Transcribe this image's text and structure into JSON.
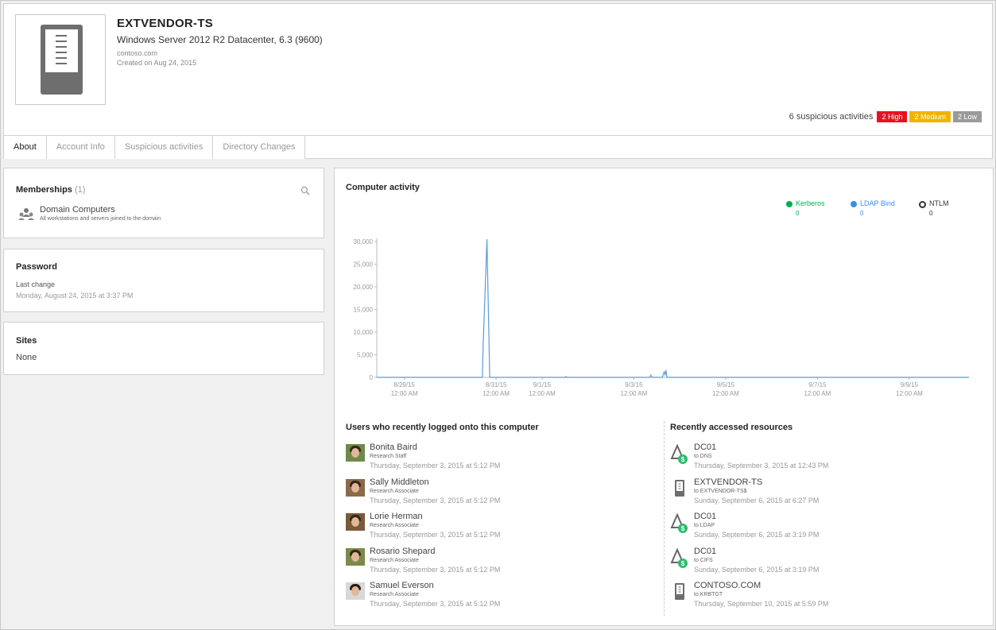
{
  "header": {
    "title": "EXTVENDOR-TS",
    "subtitle": "Windows Server 2012 R2 Datacenter, 6.3 (9600)",
    "domain": "contoso.com",
    "created": "Created on Aug 24, 2015",
    "suspicious_label": "6 suspicious activities",
    "badges": [
      {
        "label": "2 High",
        "color": "#e81123"
      },
      {
        "label": "2 Medium",
        "color": "#f0b400"
      },
      {
        "label": "2 Low",
        "color": "#9a9a9a"
      }
    ]
  },
  "tabs": [
    "About",
    "Account Info",
    "Suspicious activities",
    "Directory Changes"
  ],
  "memberships": {
    "title": "Memberships",
    "count": "(1)",
    "group_name": "Domain Computers",
    "group_desc": "All workstations and servers joined to the domain"
  },
  "password": {
    "title": "Password",
    "label": "Last change",
    "value": "Monday, August 24, 2015 at 3:37 PM"
  },
  "sites": {
    "title": "Sites",
    "value": "None"
  },
  "activity": {
    "title": "Computer activity",
    "legend": [
      {
        "name": "Kerberos",
        "value": "0",
        "color": "#00b050"
      },
      {
        "name": "LDAP Bind",
        "value": "0",
        "color": "#3a8ee6"
      },
      {
        "name": "NTLM",
        "value": "0",
        "color": "#333333"
      }
    ]
  },
  "chart_data": {
    "type": "line",
    "title": "Computer activity",
    "ylim": [
      0,
      30000
    ],
    "yticks": [
      "0",
      "5,000",
      "10,000",
      "15,000",
      "20,000",
      "25,000",
      "30,000"
    ],
    "xticks": [
      {
        "date": "8/29/15",
        "time": "12:00 AM",
        "day": 0
      },
      {
        "date": "8/31/15",
        "time": "12:00 AM",
        "day": 2
      },
      {
        "date": "9/1/15",
        "time": "12:00 AM",
        "day": 3
      },
      {
        "date": "9/3/15",
        "time": "12:00 AM",
        "day": 5
      },
      {
        "date": "9/5/15",
        "time": "12:00 AM",
        "day": 7
      },
      {
        "date": "9/7/15",
        "time": "12:00 AM",
        "day": 9
      },
      {
        "date": "9/9/15",
        "time": "12:00 AM",
        "day": 11
      }
    ],
    "series": [
      {
        "name": "LDAP Bind",
        "color": "#5b9bd5",
        "points": [
          [
            -0.6,
            0
          ],
          [
            1.7,
            0
          ],
          [
            1.72,
            8000
          ],
          [
            1.8,
            30500
          ],
          [
            1.86,
            0
          ],
          [
            2.9,
            0
          ],
          [
            3.5,
            0
          ],
          [
            3.52,
            200
          ],
          [
            3.54,
            0
          ],
          [
            5.0,
            0
          ],
          [
            5.35,
            0
          ],
          [
            5.37,
            500
          ],
          [
            5.4,
            0
          ],
          [
            5.62,
            0
          ],
          [
            5.66,
            1200
          ],
          [
            5.68,
            600
          ],
          [
            5.7,
            1600
          ],
          [
            5.72,
            0
          ],
          [
            12.3,
            0
          ]
        ]
      }
    ],
    "xmin_day": -0.6,
    "xmax_day": 12.3
  },
  "users": {
    "title": "Users who recently logged onto this computer",
    "items": [
      {
        "name": "Bonita Baird",
        "role": "Research Staff",
        "time": "Thursday, September 3, 2015 at 5:12 PM"
      },
      {
        "name": "Sally Middleton",
        "role": "Research Associate",
        "time": "Thursday, September 3, 2015 at 5:12 PM"
      },
      {
        "name": "Lorie Herman",
        "role": "Research Associate",
        "time": "Thursday, September 3, 2015 at 5:12 PM"
      },
      {
        "name": "Rosario Shepard",
        "role": "Research Associate",
        "time": "Thursday, September 3, 2015 at 5:12 PM"
      },
      {
        "name": "Samuel Everson",
        "role": "Research Associate",
        "time": "Thursday, September 3, 2015 at 5:12 PM"
      }
    ]
  },
  "resources": {
    "title": "Recently accessed resources",
    "items": [
      {
        "name": "DC01",
        "target": "to DNS",
        "time": "Thursday, September 3, 2015 at 12:43 PM",
        "icon": "domain-controller-icon"
      },
      {
        "name": "EXTVENDOR-TS",
        "target": "to EXTVENDOR-TS$",
        "time": "Sunday, September 6, 2015 at 6:27 PM",
        "icon": "computer-icon"
      },
      {
        "name": "DC01",
        "target": "to LDAP",
        "time": "Sunday, September 6, 2015 at 3:19 PM",
        "icon": "domain-controller-icon"
      },
      {
        "name": "DC01",
        "target": "to CIFS",
        "time": "Sunday, September 6, 2015 at 3:19 PM",
        "icon": "domain-controller-icon"
      },
      {
        "name": "CONTOSO.COM",
        "target": "to KRBTGT",
        "time": "Thursday, September 10, 2015 at 5:59 PM",
        "icon": "computer-icon"
      }
    ]
  }
}
